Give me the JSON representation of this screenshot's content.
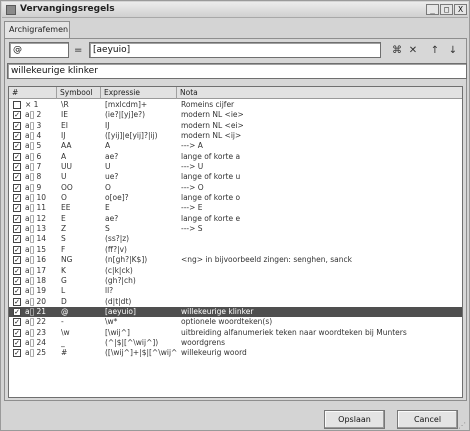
{
  "window": {
    "title": "Vervangingsregels",
    "controls": {
      "minimize": "_",
      "maximize": "□",
      "close": "X"
    }
  },
  "tabs": [
    {
      "label": "Archigrafemen"
    }
  ],
  "editor": {
    "symbol_value": "@",
    "equals": "=",
    "expression_value": "[aeyuio]",
    "note_value": "willekeurige klinker",
    "tools": [
      "hide-tool-icon",
      "delete-tool-icon",
      "move-up-arrow-icon",
      "move-down-arrow-icon"
    ]
  },
  "table": {
    "columns": [
      "#",
      "Symbool",
      "Expressie",
      "Nota"
    ],
    "rows": [
      {
        "checked": false,
        "num": "× 1",
        "symbol": "\\R",
        "expression": "[mxlcdm]+",
        "note": "Romeins cijfer"
      },
      {
        "checked": true,
        "num": "a⃝ 2",
        "symbol": "IE",
        "expression": "(ie?|[yj]e?)",
        "note": "modern NL <ie>"
      },
      {
        "checked": true,
        "num": "a⃝ 3",
        "symbol": "EI",
        "expression": "IJ",
        "note": "modern NL <ei>"
      },
      {
        "checked": true,
        "num": "a⃝ 4",
        "symbol": "IJ",
        "expression": "([yij]|e[yij]?|ij)",
        "note": "modern NL <ij>"
      },
      {
        "checked": true,
        "num": "a⃝ 5",
        "symbol": "AA",
        "expression": "A",
        "note": "---> A"
      },
      {
        "checked": true,
        "num": "a⃝ 6",
        "symbol": "A",
        "expression": "ae?",
        "note": "lange of korte a"
      },
      {
        "checked": true,
        "num": "a⃝ 7",
        "symbol": "UU",
        "expression": "U",
        "note": "---> U"
      },
      {
        "checked": true,
        "num": "a⃝ 8",
        "symbol": "U",
        "expression": "ue?",
        "note": "lange of korte u"
      },
      {
        "checked": true,
        "num": "a⃝ 9",
        "symbol": "OO",
        "expression": "O",
        "note": "---> O"
      },
      {
        "checked": true,
        "num": "a⃝ 10",
        "symbol": "O",
        "expression": "o[oe]?",
        "note": "lange of korte o"
      },
      {
        "checked": true,
        "num": "a⃝ 11",
        "symbol": "EE",
        "expression": "E",
        "note": "---> E"
      },
      {
        "checked": true,
        "num": "a⃝ 12",
        "symbol": "E",
        "expression": "ae?",
        "note": "lange of korte e"
      },
      {
        "checked": true,
        "num": "a⃝ 13",
        "symbol": "Z",
        "expression": "S",
        "note": "---> S"
      },
      {
        "checked": true,
        "num": "a⃝ 14",
        "symbol": "S",
        "expression": "(ss?|z)",
        "note": ""
      },
      {
        "checked": true,
        "num": "a⃝ 15",
        "symbol": "F",
        "expression": "(ff?|v)",
        "note": ""
      },
      {
        "checked": true,
        "num": "a⃝ 16",
        "symbol": "NG",
        "expression": "(n[gh?|K$])",
        "note": "<ng> in bijvoorbeeld zingen: senghen, sanck"
      },
      {
        "checked": true,
        "num": "a⃝ 17",
        "symbol": "K",
        "expression": "(c|k|ck)",
        "note": ""
      },
      {
        "checked": true,
        "num": "a⃝ 18",
        "symbol": "G",
        "expression": "(gh?|ch)",
        "note": ""
      },
      {
        "checked": true,
        "num": "a⃝ 19",
        "symbol": "L",
        "expression": "ll?",
        "note": ""
      },
      {
        "checked": true,
        "num": "a⃝ 20",
        "symbol": "D",
        "expression": "(d|t|dt)",
        "note": ""
      },
      {
        "checked": true,
        "num": "a⃝ 21",
        "symbol": "@",
        "expression": "[aeyuio]",
        "note": "willekeurige klinker",
        "selected": true
      },
      {
        "checked": true,
        "num": "a⃝ 22",
        "symbol": "-",
        "expression": "\\w*",
        "note": "optionele woordteken(s)"
      },
      {
        "checked": true,
        "num": "a⃝ 23",
        "symbol": "\\w",
        "expression": "[\\wij^]",
        "note": "uitbreiding alfanumeriek teken naar woordteken bij Munters"
      },
      {
        "checked": true,
        "num": "a⃝ 24",
        "symbol": "_",
        "expression": "(^|$|[^\\wij^])",
        "note": "woordgrens"
      },
      {
        "checked": true,
        "num": "a⃝ 25",
        "symbol": "#",
        "expression": "([\\wij^]+|$|[^\\wij^])",
        "note": "willekeurig woord"
      }
    ]
  },
  "footer": {
    "save_label": "Opslaan",
    "cancel_label": "Cancel"
  }
}
